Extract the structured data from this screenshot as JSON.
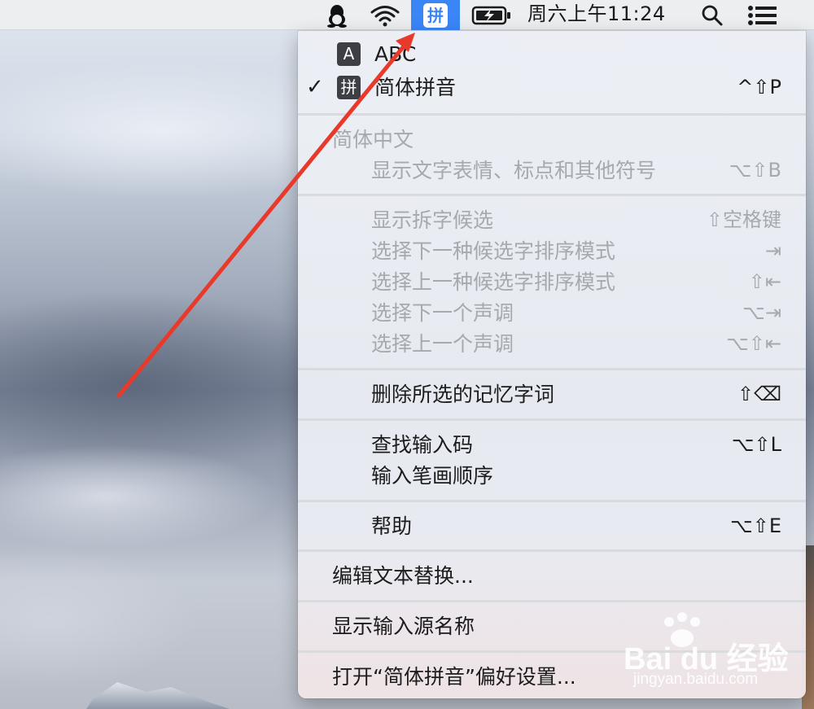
{
  "menubar": {
    "ime_glyph": "拼",
    "clock": "周六上午11:24",
    "icons": [
      "qq-penguin-icon",
      "wifi-icon",
      "input-source-icon",
      "battery-charging-icon",
      "search-icon",
      "notification-list-icon"
    ]
  },
  "menu": {
    "sources": [
      {
        "icon": "A",
        "label": "ABC",
        "checked": false,
        "shortcut": ""
      },
      {
        "icon": "拼",
        "label": "简体拼音",
        "checked": true,
        "checkmark": "✓",
        "shortcut": "^⇧P"
      }
    ],
    "section_header": "简体中文",
    "show_emoji": {
      "label": "显示文字表情、标点和其他符号",
      "shortcut": "⌥⇧B"
    },
    "candidates": [
      {
        "label": "显示拆字候选",
        "shortcut": "⇧空格键"
      },
      {
        "label": "选择下一种候选字排序模式",
        "shortcut": "⇥"
      },
      {
        "label": "选择上一种候选字排序模式",
        "shortcut": "⇧⇤"
      },
      {
        "label": "选择下一个声调",
        "shortcut": "⌥⇥"
      },
      {
        "label": "选择上一个声调",
        "shortcut": "⌥⇧⇤"
      }
    ],
    "delete_memory": {
      "label": "删除所选的记忆字词",
      "shortcut": "⇧⌫"
    },
    "lookup": {
      "label": "查找输入码",
      "shortcut": "⌥⇧L"
    },
    "stroke_order": {
      "label": "输入笔画顺序",
      "shortcut": ""
    },
    "help": {
      "label": "帮助",
      "shortcut": "⌥⇧E"
    },
    "edit_replacements": {
      "label": "编辑文本替换..."
    },
    "show_source_name": {
      "label": "显示输入源名称"
    },
    "open_prefs": {
      "label": "打开“简体拼音”偏好设置..."
    }
  },
  "watermark": {
    "brand": "Bai du 经验",
    "url": "jingyan.baidu.com"
  },
  "colors": {
    "menubar_bg": "#eceef0",
    "ime_active_bg": "#3a86f7",
    "menu_text": "#1c1c1c",
    "menu_disabled_text": "#a6a9ae",
    "arrow": "#e8392b"
  }
}
